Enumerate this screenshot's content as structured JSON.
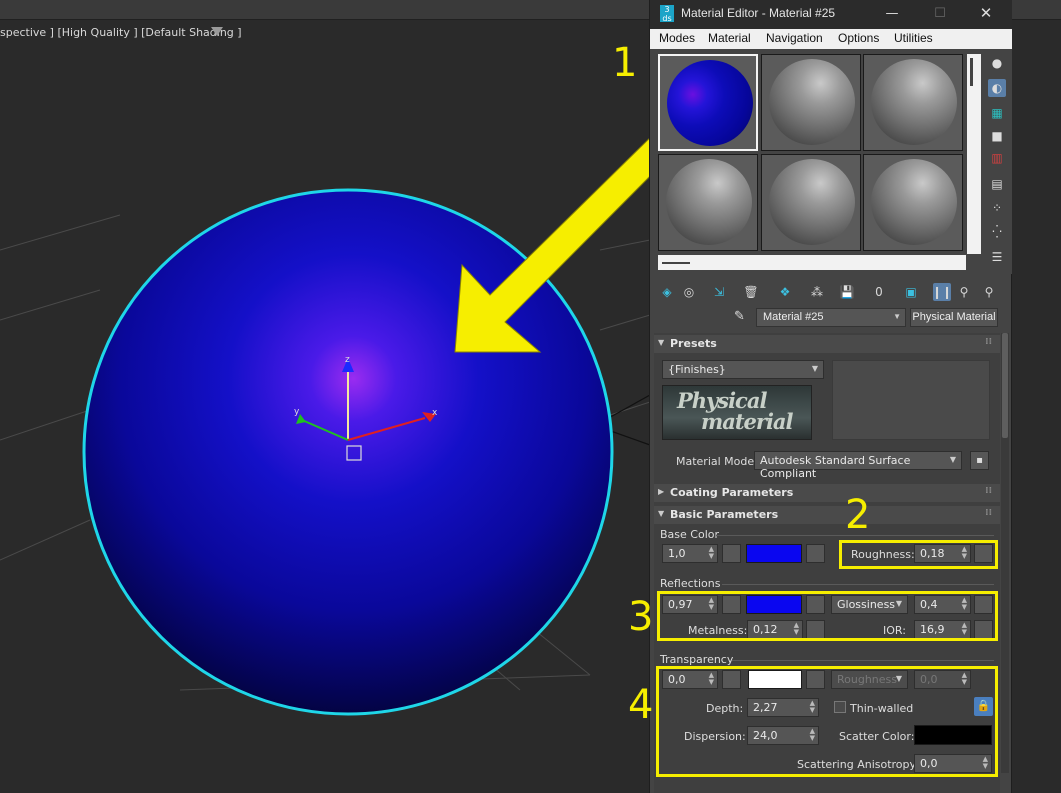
{
  "viewport": {
    "label": "spective ] [High Quality ] [Default Shading ]",
    "axis_z": "z",
    "axis_x": "x",
    "axis_y": "y"
  },
  "window": {
    "app_icon": "3 ds",
    "title": "Material Editor - Material #25",
    "minimize": "—",
    "maximize": "☐",
    "close": "✕"
  },
  "menu": [
    "Modes",
    "Material",
    "Navigation",
    "Options",
    "Utilities"
  ],
  "material_name": "Material #25",
  "material_type": "Physical Material",
  "presets": {
    "title": "Presets",
    "dropdown": "{Finishes}",
    "logo_line1": "Physical",
    "logo_line2": "material",
    "mode_label": "Material Mode:",
    "mode_value": "Autodesk Standard Surface Compliant"
  },
  "coating": {
    "title": "Coating Parameters"
  },
  "basic": {
    "title": "Basic Parameters",
    "base_color_group": "Base Color",
    "base_weight": "1,0",
    "base_color": "#0a06f0",
    "roughness_label": "Roughness:",
    "roughness_value": "0,18",
    "reflections_group": "Reflections",
    "refl_weight": "0,97",
    "refl_color": "#0a06f0",
    "gloss_mode": "Glossiness",
    "gloss_value": "0,4",
    "metalness_label": "Metalness:",
    "metalness_value": "0,12",
    "ior_label": "IOR:",
    "ior_value": "16,9",
    "transparency_group": "Transparency",
    "trans_weight": "0,0",
    "trans_color": "#ffffff",
    "trans_rough_mode": "Roughness",
    "trans_rough_value": "0,0",
    "depth_label": "Depth:",
    "depth_value": "2,27",
    "thin_walled_label": "Thin-walled",
    "dispersion_label": "Dispersion:",
    "dispersion_value": "24,0",
    "scatter_color_label": "Scatter Color:",
    "scatter_color": "#000000",
    "scatter_aniso_label": "Scattering Anisotropy:",
    "scatter_aniso_value": "0,0"
  },
  "annotations": [
    "1",
    "2",
    "3",
    "4"
  ],
  "colors": {
    "highlight": "#f6ee00",
    "selection": "#1fd6e8"
  }
}
